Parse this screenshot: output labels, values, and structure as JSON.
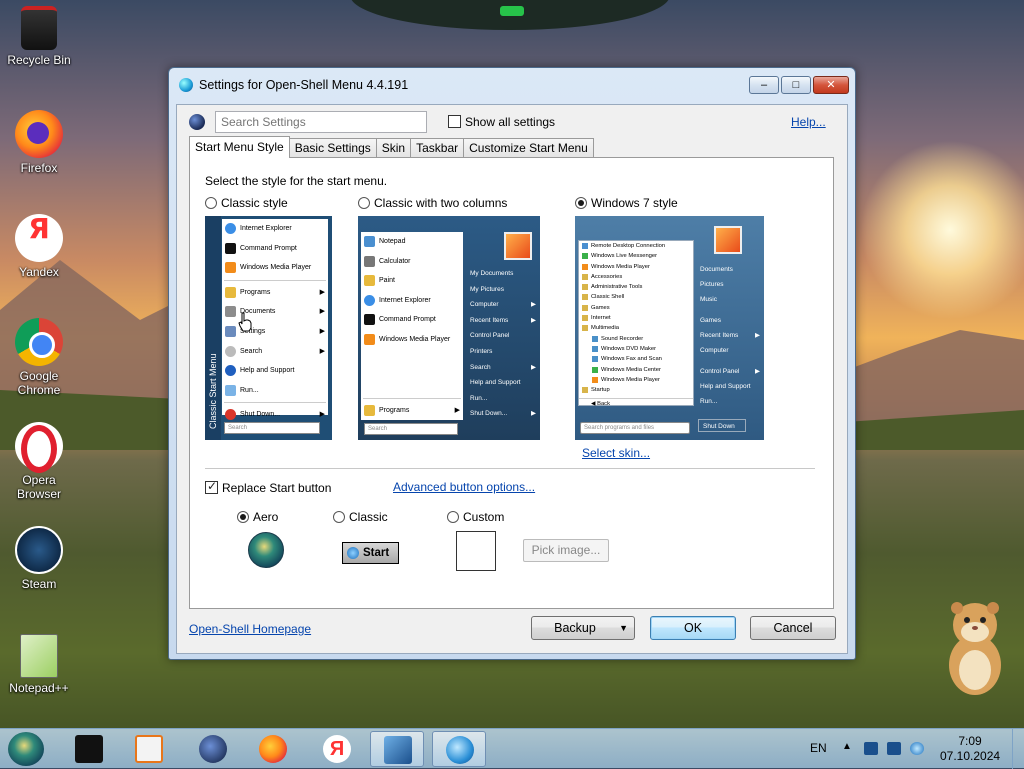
{
  "desktop": {
    "icons": [
      {
        "label": "Recycle Bin",
        "icon": "recycle-bin-icon"
      },
      {
        "label": "Firefox",
        "icon": "firefox-icon"
      },
      {
        "label": "Yandex",
        "icon": "yandex-icon"
      },
      {
        "label": "Google Chrome",
        "icon": "chrome-icon"
      },
      {
        "label": "Opera Browser",
        "icon": "opera-icon"
      },
      {
        "label": "Steam",
        "icon": "steam-icon"
      },
      {
        "label": "Notepad++",
        "icon": "notepad-plus-plus-icon"
      }
    ]
  },
  "window": {
    "title": "Settings for Open-Shell Menu 4.4.191",
    "controls": {
      "minimize": "–",
      "maximize": "□",
      "close": "✕"
    },
    "search": {
      "placeholder": "Search Settings"
    },
    "show_all_label": "Show all settings",
    "show_all_checked": false,
    "help_label": "Help...",
    "tabs": [
      {
        "label": "Start Menu Style",
        "active": true
      },
      {
        "label": "Basic Settings",
        "active": false
      },
      {
        "label": "Skin",
        "active": false
      },
      {
        "label": "Taskbar",
        "active": false
      },
      {
        "label": "Customize Start Menu",
        "active": false
      }
    ],
    "panel": {
      "prompt": "Select the style for the start menu.",
      "styles": [
        {
          "label": "Classic style",
          "selected": false
        },
        {
          "label": "Classic with two columns",
          "selected": false
        },
        {
          "label": "Windows 7 style",
          "selected": true
        }
      ],
      "classic_preview": {
        "strip_label": "Classic Start Menu",
        "items": [
          "Internet Explorer",
          "Command Prompt",
          "Windows Media Player",
          "Programs",
          "Documents",
          "Settings",
          "Search",
          "Help and Support",
          "Run...",
          "Shut Down..."
        ],
        "search": "Search"
      },
      "two_col_preview": {
        "left_items": [
          "Notepad",
          "Calculator",
          "Paint",
          "Internet Explorer",
          "Command Prompt",
          "Windows Media Player"
        ],
        "programs": "Programs",
        "search": "Search",
        "right_items": [
          "My Documents",
          "My Pictures",
          "Computer",
          "Recent Items",
          "Control Panel",
          "Printers",
          "Search",
          "Help and Support",
          "Run...",
          "Shut Down..."
        ]
      },
      "w7_preview": {
        "left_items": [
          "Remote Desktop Connection",
          "Windows Live Messenger",
          "Windows Media Player",
          "Accessories",
          "Administrative Tools",
          "Classic Shell",
          "Games",
          "Internet",
          "Multimedia",
          "Sound Recorder",
          "Windows DVD Maker",
          "Windows Fax and Scan",
          "Windows Media Center",
          "Windows Media Player",
          "Startup"
        ],
        "back": "Back",
        "search": "Search programs and files",
        "right_items": [
          "Documents",
          "Pictures",
          "Music",
          "Games",
          "Recent Items",
          "Computer",
          "Control Panel",
          "Help and Support",
          "Run..."
        ],
        "shutdown": "Shut Down"
      },
      "select_skin": "Select skin...",
      "replace_start_label": "Replace Start button",
      "replace_start_checked": true,
      "advanced_button_options": "Advanced button options...",
      "button_styles": [
        {
          "label": "Aero",
          "selected": true
        },
        {
          "label": "Classic",
          "selected": false
        },
        {
          "label": "Custom",
          "selected": false
        }
      ],
      "classic_button_text": "Start",
      "pick_image": "Pick image..."
    },
    "homepage_link": "Open-Shell Homepage",
    "buttons": {
      "backup": "Backup",
      "ok": "OK",
      "cancel": "Cancel"
    }
  },
  "taskbar": {
    "language": "EN",
    "tray_up": "▲",
    "time": "7:09",
    "date": "07.10.2024"
  }
}
